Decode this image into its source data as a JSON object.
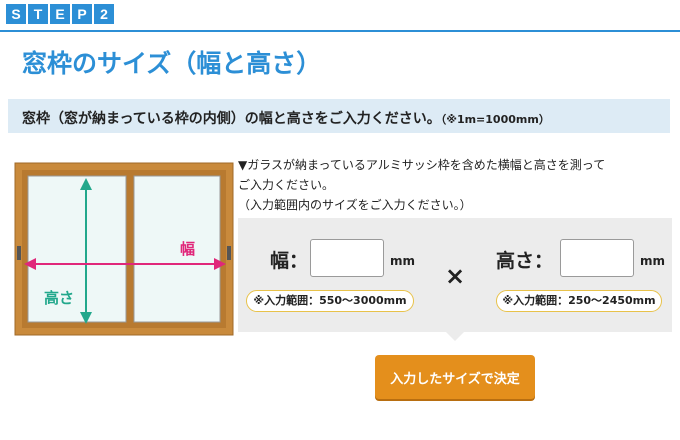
{
  "step": {
    "letters": [
      "S",
      "T",
      "E",
      "P",
      "2"
    ]
  },
  "title": "窓枠のサイズ（幅と高さ）",
  "band": {
    "main_text": "窓枠（窓が納まっている枠の内側）の幅と高さをご入力ください。",
    "note": "（※1m=1000mm）"
  },
  "illustration": {
    "width_label": "幅",
    "height_label": "高さ",
    "frame_color": "#c98a3c",
    "width_arrow_color": "#e0277a",
    "height_arrow_color": "#22a88c"
  },
  "instructions": {
    "line1": "▼ガラスが納まっているアルミサッシ枠を含めた横幅と高さを測って",
    "line2": "ご入力ください。",
    "line3": "（入力範囲内のサイズをご入力ください。）"
  },
  "width_field": {
    "label": "幅：",
    "value": "",
    "placeholder": "",
    "unit": "mm",
    "range": "※入力範囲：550〜3000mm"
  },
  "times_symbol": "×",
  "height_field": {
    "label": "高さ：",
    "value": "",
    "placeholder": "",
    "unit": "mm",
    "range": "※入力範囲：250〜2450mm"
  },
  "submit_label": "入力したサイズで決定",
  "colors": {
    "accent": "#2c8fd6",
    "band": "#ddebf5",
    "button": "#e48f1c",
    "range_border": "#e8c24a"
  }
}
